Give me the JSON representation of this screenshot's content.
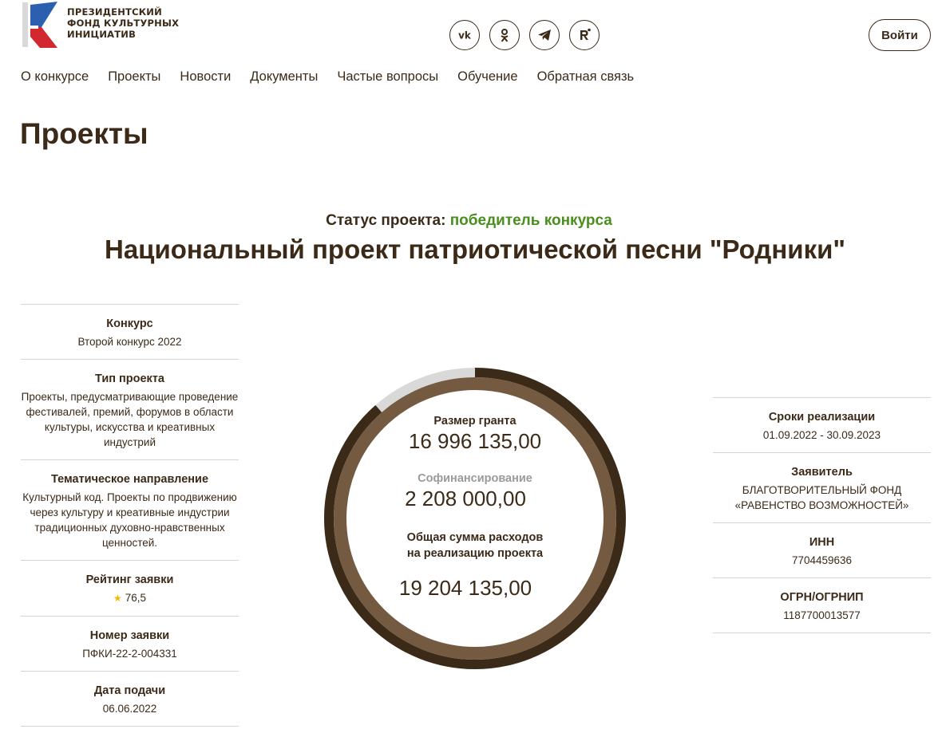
{
  "header": {
    "logo_lines": [
      "ПРЕЗИДЕНТСКИЙ",
      "ФОНД КУЛЬТУРНЫХ",
      "ИНИЦИАТИВ"
    ],
    "socials": [
      "vk-icon",
      "ok-icon",
      "telegram-icon",
      "rutube-icon"
    ],
    "login_label": "Войти"
  },
  "nav": [
    "О конкурсе",
    "Проекты",
    "Новости",
    "Документы",
    "Частые вопросы",
    "Обучение",
    "Обратная связь"
  ],
  "page_title": "Проекты",
  "status": {
    "label": "Статус проекта:",
    "value": "победитель конкурса"
  },
  "project_title": "Национальный проект патриотической песни \"Родники\"",
  "left_info": [
    {
      "label": "Конкурс",
      "value": "Второй конкурс 2022"
    },
    {
      "label": "Тип проекта",
      "value": "Проекты, предусматривающие проведение фестивалей, премий, форумов в области культуры, искусства и креативных индустрий"
    },
    {
      "label": "Тематическое направление",
      "value": "Культурный код. Проекты по продвижению через культуру и креативные индустрии традиционных духовно-нравственных ценностей."
    },
    {
      "label": "Рейтинг заявки",
      "value": "76,5"
    },
    {
      "label": "Номер заявки",
      "value": "ПФКИ-22-2-004331"
    },
    {
      "label": "Дата подачи",
      "value": "06.06.2022"
    }
  ],
  "right_info": [
    {
      "label": "Сроки реализации",
      "value": "01.09.2022 - 30.09.2023"
    },
    {
      "label": "Заявитель",
      "value": "БЛАГОТВОРИТЕЛЬНЫЙ ФОНД «РАВЕНСТВО ВОЗМОЖНОСТЕЙ»"
    },
    {
      "label": "ИНН",
      "value": "7704459636"
    },
    {
      "label": "ОГРН/ОГРНИП",
      "value": "1187700013577"
    }
  ],
  "finance": {
    "grant_label": "Размер гранта",
    "grant_value": "16 996 135,00",
    "cofin_label": "Софинансирование",
    "cofin_value": "2 208 000,00",
    "total_label": "Общая сумма расходов на реализацию проекта",
    "total_value": "19 204 135,00",
    "grant_share": 0.885
  },
  "colors": {
    "dark": "#3b2a18",
    "ring_inner": "#735a41",
    "ring_cofin": "#d9d9d9",
    "status_green": "#4a8f1e",
    "star": "#f2b900"
  }
}
